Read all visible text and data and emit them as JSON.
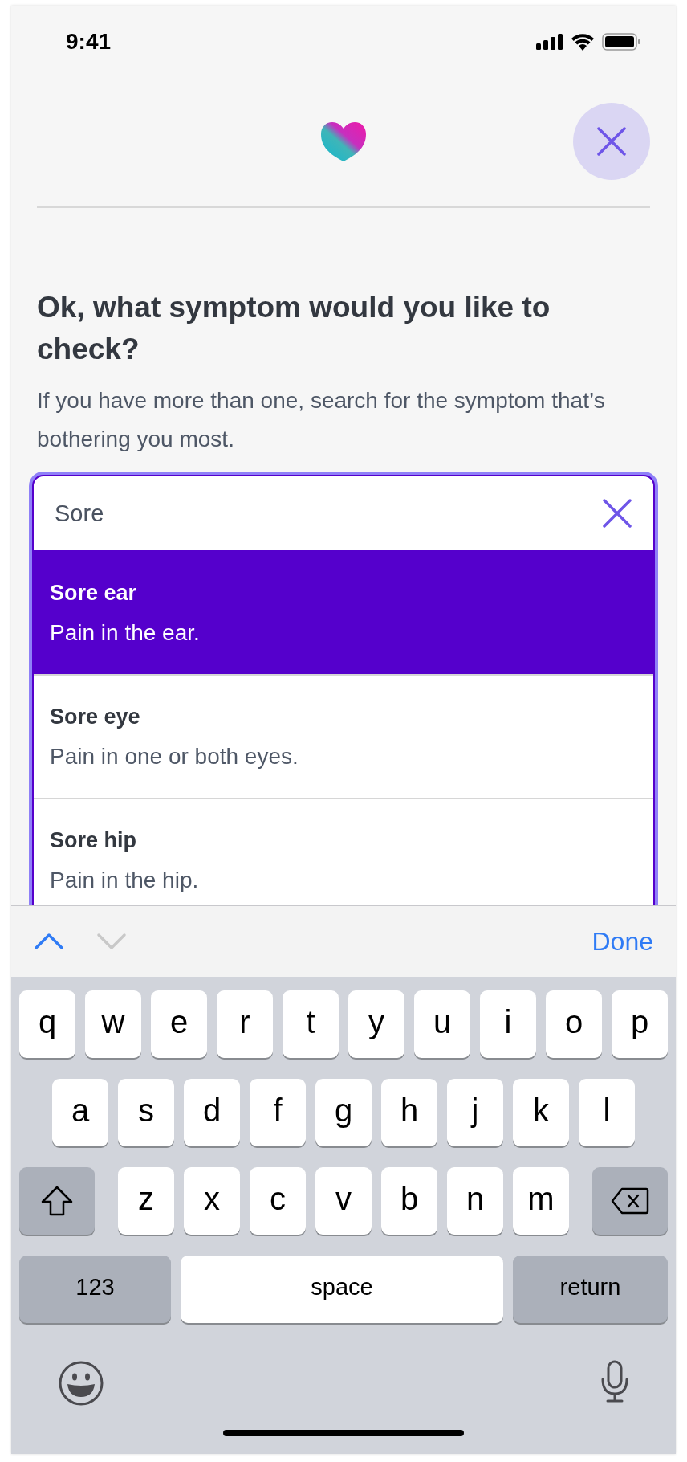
{
  "status_bar": {
    "time": "9:41"
  },
  "question": {
    "title": "Ok, what symptom would you like to check?",
    "subtitle": "If you have more than one, search for the symptom that’s bothering you most."
  },
  "search": {
    "value": "Sore"
  },
  "results": [
    {
      "title": "Sore ear",
      "description": "Pain in the ear.",
      "selected": true
    },
    {
      "title": "Sore eye",
      "description": "Pain in one or both eyes.",
      "selected": false
    },
    {
      "title": "Sore hip",
      "description": "Pain in the hip.",
      "selected": false
    }
  ],
  "keyboard_toolbar": {
    "previous_disabled": false,
    "next_disabled": true,
    "done": "Done"
  },
  "keyboard": {
    "rows": [
      [
        "q",
        "w",
        "e",
        "r",
        "t",
        "y",
        "u",
        "i",
        "o",
        "p"
      ],
      [
        "a",
        "s",
        "d",
        "f",
        "g",
        "h",
        "j",
        "k",
        "l"
      ],
      [
        "z",
        "x",
        "c",
        "v",
        "b",
        "n",
        "m"
      ]
    ],
    "numbers_key": "123",
    "space_key": "space",
    "return_key": "return"
  }
}
